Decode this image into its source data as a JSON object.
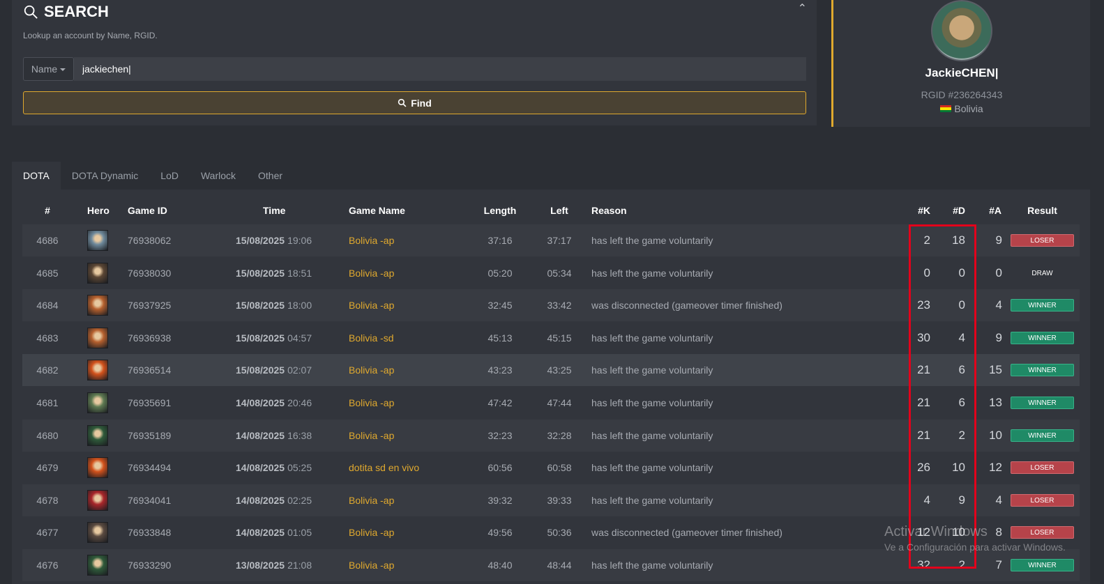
{
  "search": {
    "title": "SEARCH",
    "subtitle": "Lookup an account by Name, RGID.",
    "select_value": "Name",
    "input_value": "jackiechen|",
    "find_label": "Find"
  },
  "profile": {
    "name": "JackieCHEN|",
    "rgid": "RGID #236264343",
    "country": "Bolivia"
  },
  "tabs": [
    "DOTA",
    "DOTA Dynamic",
    "LoD",
    "Warlock",
    "Other"
  ],
  "columns": [
    "#",
    "Hero",
    "Game ID",
    "Time",
    "Game Name",
    "Length",
    "Left",
    "Reason",
    "#K",
    "#D",
    "#A",
    "Result"
  ],
  "rows": [
    {
      "num": "4686",
      "gid": "76938062",
      "date": "15/08/2025",
      "time": "19:06",
      "gname": "Bolivia -ap",
      "len": "37:16",
      "left": "37:17",
      "reason": "has left the game voluntarily",
      "k": "2",
      "d": "18",
      "a": "9",
      "result": "LOSER",
      "rclass": "loser",
      "hero": "#6f8a9c"
    },
    {
      "num": "4685",
      "gid": "76938030",
      "date": "15/08/2025",
      "time": "18:51",
      "gname": "Bolivia -ap",
      "len": "05:20",
      "left": "05:34",
      "reason": "has left the game voluntarily",
      "k": "0",
      "d": "0",
      "a": "0",
      "result": "DRAW",
      "rclass": "draw",
      "hero": "#5b4634"
    },
    {
      "num": "4684",
      "gid": "76937925",
      "date": "15/08/2025",
      "time": "18:00",
      "gname": "Bolivia -ap",
      "len": "32:45",
      "left": "33:42",
      "reason": "was disconnected (gameover timer finished)",
      "k": "23",
      "d": "0",
      "a": "4",
      "result": "WINNER",
      "rclass": "winner",
      "hero": "#b5602e"
    },
    {
      "num": "4683",
      "gid": "76936938",
      "date": "15/08/2025",
      "time": "04:57",
      "gname": "Bolivia -sd",
      "len": "45:13",
      "left": "45:15",
      "reason": "has left the game voluntarily",
      "k": "30",
      "d": "4",
      "a": "9",
      "result": "WINNER",
      "rclass": "winner",
      "hero": "#b5602e"
    },
    {
      "num": "4682",
      "gid": "76936514",
      "date": "15/08/2025",
      "time": "02:07",
      "gname": "Bolivia -ap",
      "len": "43:23",
      "left": "43:25",
      "reason": "has left the game voluntarily",
      "k": "21",
      "d": "6",
      "a": "15",
      "result": "WINNER",
      "rclass": "winner",
      "hero": "#d2521c"
    },
    {
      "num": "4681",
      "gid": "76935691",
      "date": "14/08/2025",
      "time": "20:46",
      "gname": "Bolivia -ap",
      "len": "47:42",
      "left": "47:44",
      "reason": "has left the game voluntarily",
      "k": "21",
      "d": "6",
      "a": "13",
      "result": "WINNER",
      "rclass": "winner",
      "hero": "#5e7a52"
    },
    {
      "num": "4680",
      "gid": "76935189",
      "date": "14/08/2025",
      "time": "16:38",
      "gname": "Bolivia -ap",
      "len": "32:23",
      "left": "32:28",
      "reason": "has left the game voluntarily",
      "k": "21",
      "d": "2",
      "a": "10",
      "result": "WINNER",
      "rclass": "winner",
      "hero": "#2f5a3a"
    },
    {
      "num": "4679",
      "gid": "76934494",
      "date": "14/08/2025",
      "time": "05:25",
      "gname": "dotita sd en vivo",
      "len": "60:56",
      "left": "60:58",
      "reason": "has left the game voluntarily",
      "k": "26",
      "d": "10",
      "a": "12",
      "result": "LOSER",
      "rclass": "loser",
      "hero": "#d2521c"
    },
    {
      "num": "4678",
      "gid": "76934041",
      "date": "14/08/2025",
      "time": "02:25",
      "gname": "Bolivia -ap",
      "len": "39:32",
      "left": "39:33",
      "reason": "has left the game voluntarily",
      "k": "4",
      "d": "9",
      "a": "4",
      "result": "LOSER",
      "rclass": "loser",
      "hero": "#a8262a"
    },
    {
      "num": "4677",
      "gid": "76933848",
      "date": "14/08/2025",
      "time": "01:05",
      "gname": "Bolivia -ap",
      "len": "49:56",
      "left": "50:36",
      "reason": "was disconnected (gameover timer finished)",
      "k": "12",
      "d": "10",
      "a": "8",
      "result": "LOSER",
      "rclass": "loser",
      "hero": "#5a4a40"
    },
    {
      "num": "4676",
      "gid": "76933290",
      "date": "13/08/2025",
      "time": "21:08",
      "gname": "Bolivia -ap",
      "len": "48:40",
      "left": "48:44",
      "reason": "has left the game voluntarily",
      "k": "32",
      "d": "2",
      "a": "7",
      "result": "WINNER",
      "rclass": "winner",
      "hero": "#2f5a3a"
    }
  ],
  "watermark": {
    "line1": "Activar Windows",
    "line2": "Ve a Configuración para activar Windows."
  },
  "colors": {
    "accent": "#e0a92e",
    "loser": "#b6434a",
    "winner": "#1f8a66",
    "highlight_box": "#e3001b"
  }
}
